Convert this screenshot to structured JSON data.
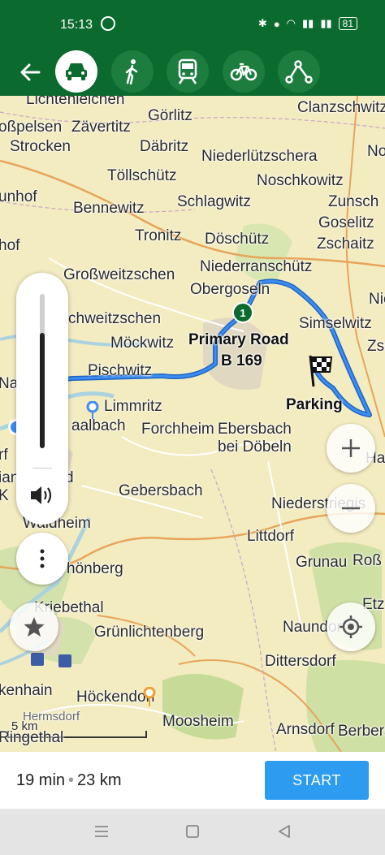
{
  "status": {
    "time": "15:13",
    "battery": "81"
  },
  "modes": [
    {
      "id": "car",
      "active": true
    },
    {
      "id": "walk",
      "active": false
    },
    {
      "id": "transit",
      "active": false
    },
    {
      "id": "bike",
      "active": false
    },
    {
      "id": "route-points",
      "active": false
    }
  ],
  "map": {
    "route_badge": "1",
    "road_label_1": "Primary Road",
    "road_label_2": "B 169",
    "destination_label": "Parking",
    "scale": "5 km",
    "places": [
      "Lichtenleichen",
      "Görlitz",
      "Clanzschwitz",
      "oßpelsen",
      "Zävertitz",
      "Strocken",
      "Däbritz",
      "Niederlützschera",
      "Töllschütz",
      "Noschkowitz",
      "Zunsch",
      "unhof",
      "Schlagwitz",
      "Bennewitz",
      "Goselitz",
      "Tronitz",
      "Döschütz",
      "Zschaitz",
      "hof",
      "Großweitzschen",
      "Niederranschütz",
      "Obergoseln",
      "Simselwitz",
      "chweitzschen",
      "Möckwitz",
      "Na",
      "Pischwitz",
      "Limmritz",
      "aalbach",
      "Forchheim",
      "Ebersbach",
      "bei Döbeln",
      "rf",
      "ian",
      "d",
      "K",
      "Gebersbach",
      "Niederstriegis",
      "Waldheim",
      "Littdorf",
      "Grunau",
      "Roß",
      "hönberg",
      "Kriebethal",
      "Etz",
      "Grünlichtenberg",
      "Naundorf",
      "Dittersdorf",
      "kenhain",
      "Höckendorf",
      "Hermsdorf",
      "Moosheim",
      "Arnsdorf",
      "Berbersd",
      "Ringethal",
      "Haß",
      "Nos",
      "Nie",
      "Zschaitz"
    ]
  },
  "volume": {
    "level": 0.75
  },
  "summary": {
    "duration": "19 min",
    "distance": "23 km",
    "start_label": "START"
  }
}
